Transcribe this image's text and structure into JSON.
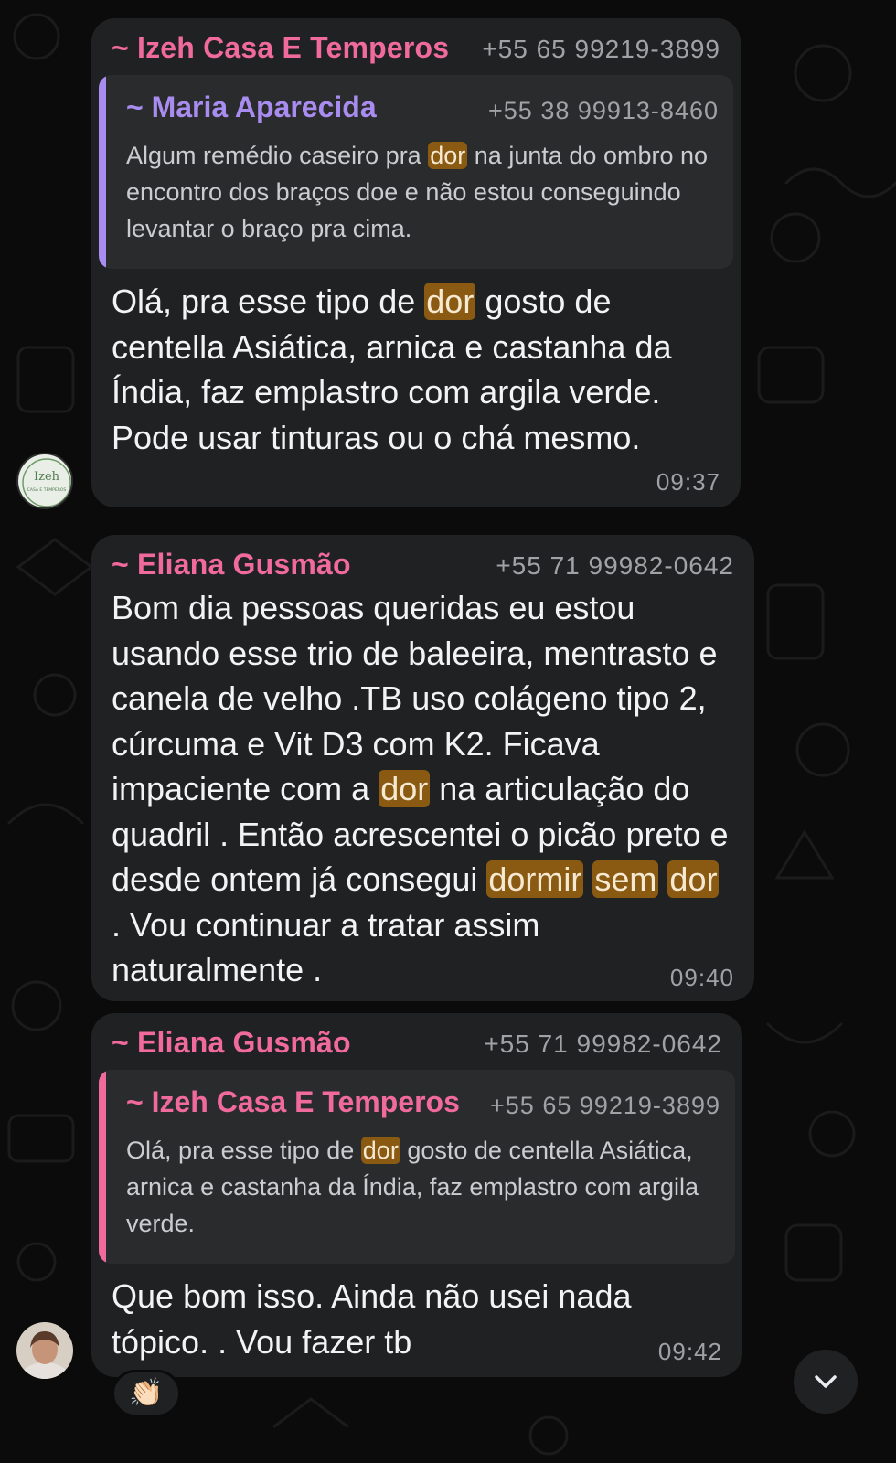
{
  "colors": {
    "background": "#0b0b0b",
    "bubble": "#202122",
    "quote_bg": "#2a2b2c",
    "name_pink": "#f06a9b",
    "name_purple": "#a98cf0",
    "highlight": "#8a5a12",
    "meta_gray": "#a0a3a6"
  },
  "messages": [
    {
      "sender": "~ Izeh Casa E Temperos",
      "phone": "+55 65 99219-3899",
      "quote": {
        "sender": "~ Maria Aparecida",
        "phone": "+55 38 99913-8460",
        "text": "Algum remédio caseiro pra dor na junta do ombro no encontro dos braços doe e não estou conseguindo levantar o braço pra cima."
      },
      "text": "Olá, pra esse tipo de dor gosto de centella Asiática, arnica e castanha da Índia, faz emplastro com argila verde. Pode usar tinturas ou o chá mesmo.",
      "time": "09:37",
      "avatar_label": "Izeh",
      "avatar_sub": "CASA E TEMPEROS"
    },
    {
      "sender": "~ Eliana Gusmão",
      "phone": "+55 71 99982-0642",
      "text": "Bom dia pessoas queridas eu estou usando esse trio de baleeira, mentrasto e canela de velho .TB uso colágeno tipo 2, cúrcuma e Vit D3 com K2. Ficava impaciente com a dor na articulação do quadril . Então acrescentei o picão preto e desde ontem já consegui dormir sem dor . Vou continuar a tratar assim naturalmente .",
      "time": "09:40"
    },
    {
      "sender": "~ Eliana Gusmão",
      "phone": "+55 71 99982-0642",
      "quote": {
        "sender": "~ Izeh Casa E Temperos",
        "phone": "+55 65 99219-3899",
        "text": "Olá, pra esse tipo de dor gosto de centella Asiática, arnica e castanha da Índia, faz emplastro com argila verde."
      },
      "text": "Que bom isso. Ainda não usei nada tópico. . Vou fazer tb",
      "time": "09:42",
      "reaction": "👏🏻"
    }
  ],
  "search_highlight_terms": [
    "dor",
    "dormir",
    "sem"
  ],
  "icons": {
    "scroll_down": "chevron-down-icon",
    "reaction": "clapping-hands-emoji"
  }
}
